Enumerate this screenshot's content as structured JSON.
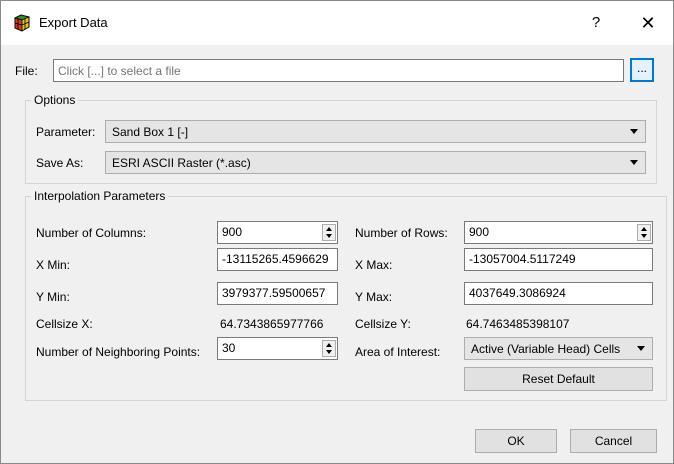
{
  "window": {
    "title": "Export Data",
    "help_label": "?",
    "close_label": "✕"
  },
  "file": {
    "label": "File:",
    "placeholder": "Click [...] to select a file",
    "browse_label": "..."
  },
  "options": {
    "group_title": "Options",
    "parameter_label": "Parameter:",
    "parameter_value": "Sand Box 1 [-]",
    "save_as_label": "Save As:",
    "save_as_value": "ESRI ASCII Raster (*.asc)"
  },
  "interpolation": {
    "group_title": "Interpolation Parameters",
    "num_columns_label": "Number of Columns:",
    "num_columns_value": "900",
    "num_rows_label": "Number of Rows:",
    "num_rows_value": "900",
    "x_min_label": "X Min:",
    "x_min_value": "-13115265.4596629",
    "x_max_label": "X Max:",
    "x_max_value": "-13057004.5117249",
    "y_min_label": "Y Min:",
    "y_min_value": "3979377.59500657",
    "y_max_label": "Y Max:",
    "y_max_value": "4037649.3086924",
    "cellsize_x_label": "Cellsize X:",
    "cellsize_x_value": "64.7343865977766",
    "cellsize_y_label": "Cellsize Y:",
    "cellsize_y_value": "64.7463485398107",
    "neighbor_points_label": "Number of Neighboring Points:",
    "neighbor_points_value": "30",
    "area_of_interest_label": "Area of Interest:",
    "area_of_interest_value": "Active (Variable Head) Cells",
    "reset_label": "Reset Default"
  },
  "footer": {
    "ok_label": "OK",
    "cancel_label": "Cancel"
  },
  "colors": {
    "accent": "#0078d7",
    "window_bg": "#f0f0f0",
    "titlebar_bg": "#ffffff"
  },
  "icons": {
    "app": "grid-cube-icon",
    "help": "question-mark",
    "close": "close-x"
  }
}
